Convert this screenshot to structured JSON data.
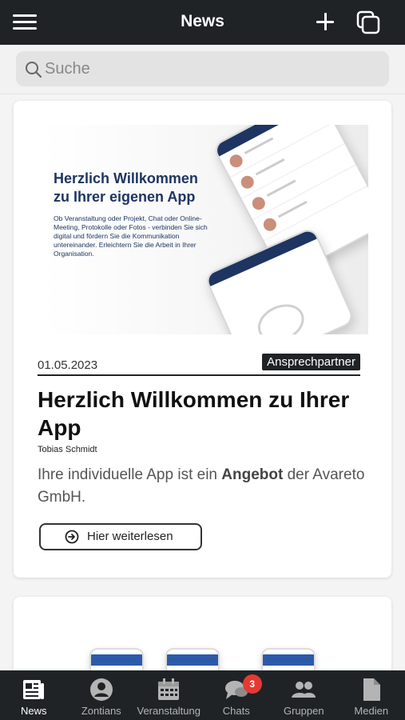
{
  "header": {
    "title": "News"
  },
  "search": {
    "placeholder": "Suche"
  },
  "article": {
    "banner_heading": "Herzlich Willkommen zu Ihrer eigenen App",
    "banner_text": "Ob Veranstaltung oder Projekt, Chat oder Online-Meeting, Protokolle oder Fotos - verbinden Sie sich digital und fördern Sie die Kommunikation untereinander. Erleichtern Sie die Arbeit in Ihrer Organisation.",
    "date": "01.05.2023",
    "tag": "Ansprechpartner",
    "title": "Herzlich Willkommen zu Ihrer App",
    "author": "Tobias Schmidt",
    "excerpt_before": "Ihre individuelle App ist ein ",
    "excerpt_bold": "Angebot",
    "excerpt_after": " der Avareto GmbH.",
    "read_more": "Hier weiterlesen"
  },
  "nav": {
    "items": [
      {
        "label": "News",
        "icon": "news-icon",
        "active": true
      },
      {
        "label": "Zontians",
        "icon": "person-icon"
      },
      {
        "label": "Veranstaltung",
        "icon": "calendar-icon"
      },
      {
        "label": "Chats",
        "icon": "chat-icon",
        "badge": "3"
      },
      {
        "label": "Gruppen",
        "icon": "group-icon"
      },
      {
        "label": "Medien",
        "icon": "document-icon"
      }
    ]
  },
  "colors": {
    "bar": "#1f2326",
    "brand_blue": "#1e3561",
    "badge": "#e53935"
  }
}
